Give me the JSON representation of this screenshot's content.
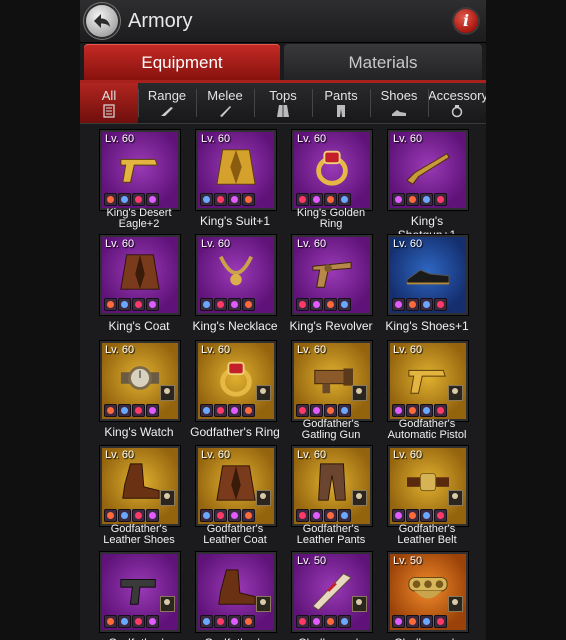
{
  "header": {
    "title": "Armory"
  },
  "tabs": [
    {
      "label": "Equipment"
    },
    {
      "label": "Materials"
    }
  ],
  "categories": [
    {
      "label": "All",
      "icon": "list-icon"
    },
    {
      "label": "Range",
      "icon": "gun-icon"
    },
    {
      "label": "Melee",
      "icon": "knife-icon"
    },
    {
      "label": "Tops",
      "icon": "jacket-icon"
    },
    {
      "label": "Pants",
      "icon": "pants-icon"
    },
    {
      "label": "Shoes",
      "icon": "shoes-icon"
    },
    {
      "label": "Accessory",
      "icon": "ring-icon"
    }
  ],
  "colors": {
    "purple": "#7a2496",
    "gold": "#c08a1c",
    "blue": "#1f4594",
    "orange": "#d0661a",
    "accent": "#a8211b"
  },
  "items": [
    {
      "level": "Lv. 60",
      "name": "King's Desert Eagle+2",
      "rarity": "purple",
      "icon": "pistol-icon"
    },
    {
      "level": "Lv. 60",
      "name": "King's Suit+1",
      "rarity": "purple",
      "icon": "suit-icon"
    },
    {
      "level": "Lv. 60",
      "name": "King's Golden Ring",
      "rarity": "purple",
      "icon": "ring-icon"
    },
    {
      "level": "Lv. 60",
      "name": "King's Shotgun+1",
      "rarity": "purple",
      "icon": "shotgun-icon"
    },
    {
      "level": "Lv. 60",
      "name": "King's Coat",
      "rarity": "purple",
      "icon": "coat-icon"
    },
    {
      "level": "Lv. 60",
      "name": "King's Necklace",
      "rarity": "purple",
      "icon": "necklace-icon"
    },
    {
      "level": "Lv. 60",
      "name": "King's Revolver",
      "rarity": "purple",
      "icon": "revolver-icon"
    },
    {
      "level": "Lv. 60",
      "name": "King's Shoes+1",
      "rarity": "blue",
      "icon": "shoes-icon"
    },
    {
      "level": "Lv. 60",
      "name": "King's Watch",
      "rarity": "gold",
      "icon": "watch-icon"
    },
    {
      "level": "Lv. 60",
      "name": "Godfather's Ring",
      "rarity": "gold",
      "icon": "ring-icon"
    },
    {
      "level": "Lv. 60",
      "name": "Godfather's Gatling Gun",
      "rarity": "gold",
      "icon": "gatling-icon"
    },
    {
      "level": "Lv. 60",
      "name": "Godfather's Automatic Pistol",
      "rarity": "gold",
      "icon": "pistol-icon"
    },
    {
      "level": "Lv. 60",
      "name": "Godfather's Leather Shoes",
      "rarity": "gold",
      "icon": "boots-icon"
    },
    {
      "level": "Lv. 60",
      "name": "Godfather's Leather Coat",
      "rarity": "gold",
      "icon": "coat-icon"
    },
    {
      "level": "Lv. 60",
      "name": "Godfather's Leather Pants",
      "rarity": "gold",
      "icon": "pants-icon"
    },
    {
      "level": "Lv. 60",
      "name": "Godfather's Leather Belt",
      "rarity": "gold",
      "icon": "belt-icon"
    },
    {
      "level": "",
      "name": "Godfather's",
      "rarity": "purple",
      "icon": "smg-icon"
    },
    {
      "level": "",
      "name": "Godfather's",
      "rarity": "purple",
      "icon": "boots-icon"
    },
    {
      "level": "Lv. 50",
      "name": "Challenger's",
      "rarity": "purple",
      "icon": "bat-icon"
    },
    {
      "level": "Lv. 50",
      "name": "Challenger's",
      "rarity": "orange",
      "icon": "knuckles-icon"
    }
  ]
}
